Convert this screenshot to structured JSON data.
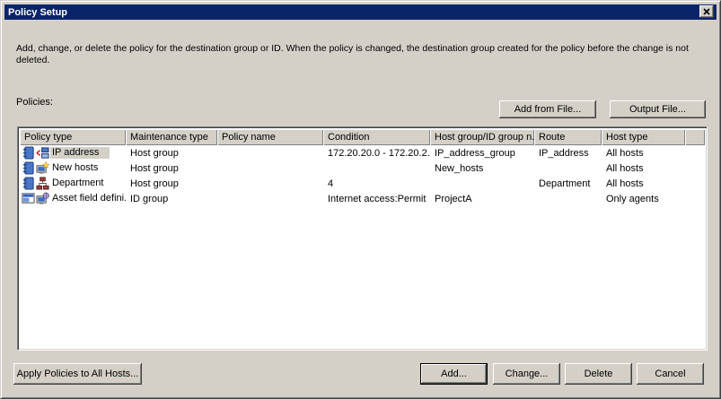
{
  "window": {
    "title": "Policy Setup",
    "close_icon": "close-icon"
  },
  "description": "Add, change, or delete the policy for the destination group or ID. When the policy is changed, the destination group created for the policy before the change is not deleted.",
  "policies_label": "Policies:",
  "toolbar": {
    "add_from_file": "Add from File...",
    "output_file": "Output File..."
  },
  "table": {
    "columns": [
      "Policy type",
      "Maintenance type",
      "Policy name",
      "Condition",
      "Host group/ID group n...",
      "Route",
      "Host type"
    ],
    "rows": [
      {
        "icons": [
          "address-book-icon",
          "ip-network-icon"
        ],
        "policy_type": "IP address",
        "maintenance_type": "Host group",
        "policy_name": "",
        "condition": "172.20.20.0 - 172.20.2...",
        "host_group_id_name": "IP_address_group",
        "route": "IP_address",
        "host_type": "All hosts",
        "selected": true
      },
      {
        "icons": [
          "address-book-icon",
          "new-host-icon"
        ],
        "policy_type": "New hosts",
        "maintenance_type": "Host group",
        "policy_name": "",
        "condition": "",
        "host_group_id_name": "New_hosts",
        "route": "",
        "host_type": "All hosts",
        "selected": false
      },
      {
        "icons": [
          "address-book-icon",
          "department-tree-icon"
        ],
        "policy_type": "Department",
        "maintenance_type": "Host group",
        "policy_name": "",
        "condition": "4",
        "host_group_id_name": "",
        "route": "Department",
        "host_type": "All hosts",
        "selected": false
      },
      {
        "icons": [
          "id-window-icon",
          "agent-host-icon"
        ],
        "policy_type": "Asset field defini...",
        "maintenance_type": "ID group",
        "policy_name": "",
        "condition": "Internet access:Permit",
        "host_group_id_name": "ProjectA",
        "route": "",
        "host_type": "Only agents",
        "selected": false
      }
    ]
  },
  "footer": {
    "apply_all": "Apply Policies to All Hosts...",
    "add": "Add...",
    "change": "Change...",
    "delete": "Delete",
    "cancel": "Cancel"
  },
  "colors": {
    "titlebar": "#0a246a",
    "dialog_bg": "#d4d0c8",
    "list_bg": "#ffffff",
    "selection_bg": "#d4d0c8"
  }
}
